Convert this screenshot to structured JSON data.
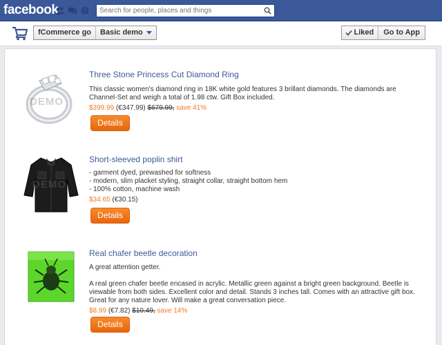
{
  "facebook": {
    "logo": "facebook",
    "search_placeholder": "Search for people, places and things",
    "icons": [
      "friend-requests-icon",
      "messages-icon",
      "notifications-icon",
      "search-icon"
    ]
  },
  "app": {
    "name": "fCommerce go",
    "demo_label": "Basic demo",
    "liked_label": "Liked",
    "goto_label": "Go to App",
    "icons": [
      "shopping-cart-icon",
      "chevron-down-icon",
      "checkmark-icon"
    ]
  },
  "watermark": "DEMO",
  "products": [
    {
      "title": "Three Stone Princess Cut Diamond Ring",
      "description": "This classic women's diamond ring in 18K white gold features 3 brillant diamonds. The diamonds are Channel-Set and weigh a total of 1.98 ctw. Gift Box included.",
      "price": "$399.99",
      "price_eur": "(€347.99)",
      "old_price": "$679.99,",
      "save": "save 41%",
      "button": "Details",
      "image_icon": "diamond-ring-image"
    },
    {
      "title": "Short-sleeved poplin shirt",
      "lines": [
        "- garment dyed, prewashed for softness",
        "- modern, slim placket styling, straight collar, straight bottom hem",
        "- 100% cotton, machine wash"
      ],
      "price": "$34.65",
      "price_eur": "(€30.15)",
      "button": "Details",
      "image_icon": "black-shirt-image"
    },
    {
      "title": "Real chafer beetle decoration",
      "tagline": "A great attention getter.",
      "description": "A real green chafer beetle encased in acrylic. Metallic green against a bright green background. Beetle is viewable from both sides. Excellent color and detail. Stands 3 inches tall. Comes with an attractive gift box. Great for any nature lover. Will make a great conversation piece.",
      "price": "$8.99",
      "price_eur": "(€7.82)",
      "old_price": "$10.49,",
      "save": "save 14%",
      "button": "Details",
      "image_icon": "beetle-acrylic-image"
    }
  ],
  "colors": {
    "facebook_blue": "#3b5998",
    "orange": "#f47920",
    "button_orange": "#ef7215"
  }
}
